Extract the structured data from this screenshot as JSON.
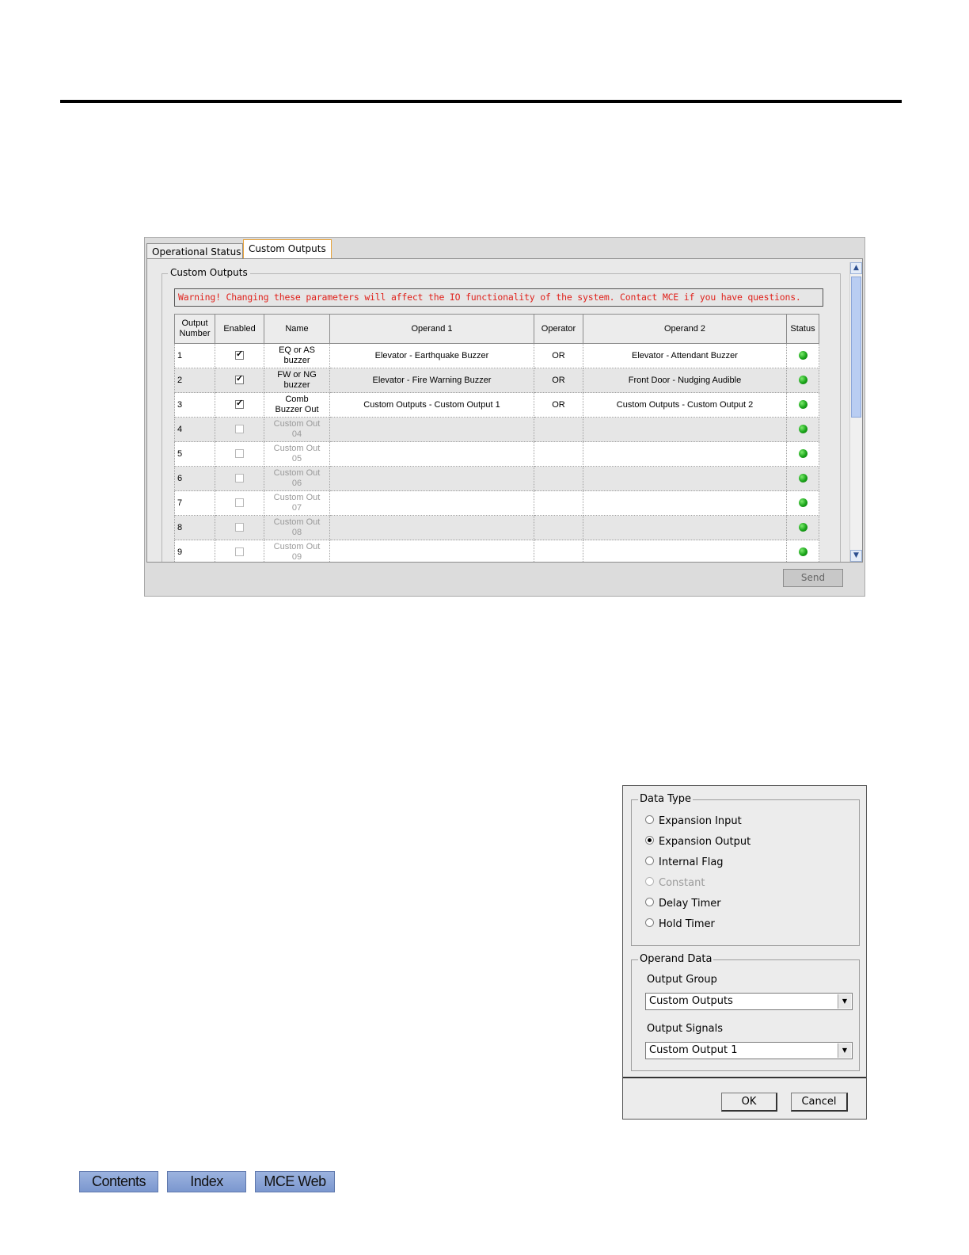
{
  "tabs": [
    "Operational Status",
    "Custom Outputs"
  ],
  "group_label": "Custom Outputs",
  "warning": "Warning! Changing these parameters will affect the IO functionality of the system. Contact MCE if you have questions.",
  "columns": [
    "Output Number",
    "Enabled",
    "Name",
    "Operand 1",
    "Operator",
    "Operand 2",
    "Status"
  ],
  "rows": [
    {
      "num": "1",
      "enabled": true,
      "name": "EQ or AS buzzer",
      "op1": "Elevator - Earthquake Buzzer",
      "operator": "OR",
      "op2": "Elevator - Attendant Buzzer"
    },
    {
      "num": "2",
      "enabled": true,
      "name": "FW or NG buzzer",
      "op1": "Elevator - Fire Warning Buzzer",
      "operator": "OR",
      "op2": "Front Door - Nudging Audible"
    },
    {
      "num": "3",
      "enabled": true,
      "name": "Comb Buzzer Out",
      "op1": "Custom Outputs - Custom Output 1",
      "operator": "OR",
      "op2": "Custom Outputs - Custom Output 2"
    },
    {
      "num": "4",
      "enabled": false,
      "name": "Custom Out 04",
      "op1": "",
      "operator": "",
      "op2": ""
    },
    {
      "num": "5",
      "enabled": false,
      "name": "Custom Out 05",
      "op1": "",
      "operator": "",
      "op2": ""
    },
    {
      "num": "6",
      "enabled": false,
      "name": "Custom Out 06",
      "op1": "",
      "operator": "",
      "op2": ""
    },
    {
      "num": "7",
      "enabled": false,
      "name": "Custom Out 07",
      "op1": "",
      "operator": "",
      "op2": ""
    },
    {
      "num": "8",
      "enabled": false,
      "name": "Custom Out 08",
      "op1": "",
      "operator": "",
      "op2": ""
    },
    {
      "num": "9",
      "enabled": false,
      "name": "Custom Out 09",
      "op1": "",
      "operator": "",
      "op2": ""
    }
  ],
  "status_color": "#19a319",
  "send_label": "Send",
  "dialog": {
    "data_type_label": "Data Type",
    "data_types": [
      {
        "label": "Expansion Input",
        "selected": false,
        "disabled": false
      },
      {
        "label": "Expansion Output",
        "selected": true,
        "disabled": false
      },
      {
        "label": "Internal Flag",
        "selected": false,
        "disabled": false
      },
      {
        "label": "Constant",
        "selected": false,
        "disabled": true
      },
      {
        "label": "Delay Timer",
        "selected": false,
        "disabled": false
      },
      {
        "label": "Hold Timer",
        "selected": false,
        "disabled": false
      }
    ],
    "operand_data_label": "Operand Data",
    "output_group_label": "Output Group",
    "output_group_value": "Custom Outputs",
    "output_signals_label": "Output Signals",
    "output_signals_value": "Custom Output 1",
    "ok_label": "OK",
    "cancel_label": "Cancel"
  },
  "nav": {
    "contents": "Contents",
    "index": "Index",
    "mce_web": "MCE Web"
  }
}
